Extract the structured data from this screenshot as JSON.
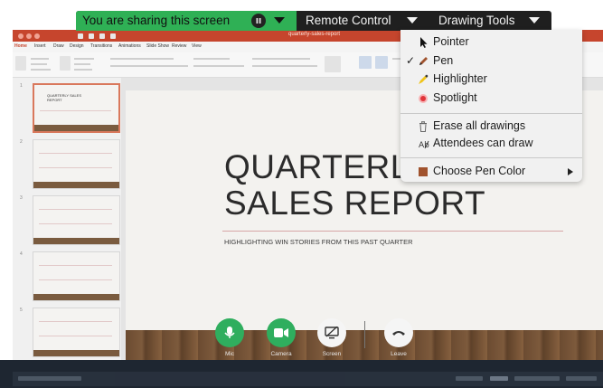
{
  "share_bar": {
    "sharing_text": "You are sharing this screen",
    "remote_control_label": "Remote Control",
    "drawing_tools_label": "Drawing Tools"
  },
  "window": {
    "document_title": "quarterly-sales-report"
  },
  "ribbon": {
    "tabs": [
      "Home",
      "Insert",
      "Draw",
      "Design",
      "Transitions",
      "Animations",
      "Slide Show",
      "Review",
      "View"
    ]
  },
  "slide": {
    "title_line1": "QUARTERLY",
    "title_line2": "SALES REPORT",
    "subtitle": "HIGHLIGHTING WIN STORIES FROM THIS PAST QUARTER",
    "thumb_title": "QUARTERLY SALES REPORT"
  },
  "thumbnails": [
    "1",
    "2",
    "3",
    "4",
    "5"
  ],
  "drawing_menu": {
    "items": [
      {
        "label": "Pointer",
        "icon": "pointer-icon"
      },
      {
        "label": "Pen",
        "icon": "pen-icon",
        "checked": true
      },
      {
        "label": "Highlighter",
        "icon": "highlighter-icon"
      },
      {
        "label": "Spotlight",
        "icon": "spotlight-icon"
      },
      {
        "label": "Erase all drawings",
        "icon": "trash-icon"
      },
      {
        "label": "Attendees can draw",
        "icon": "attendees-draw-icon"
      },
      {
        "label": "Choose Pen Color",
        "icon": "color-swatch-icon"
      }
    ],
    "check_mark": "✓",
    "pen_color": "#a0522d"
  },
  "meeting_controls": {
    "mic_label": "Mic",
    "camera_label": "Camera",
    "screen_label": "Screen",
    "leave_label": "Leave"
  },
  "colors": {
    "share_green": "#2fb055",
    "control_green": "#2fae5e",
    "spotlight_red": "#e0343a"
  }
}
